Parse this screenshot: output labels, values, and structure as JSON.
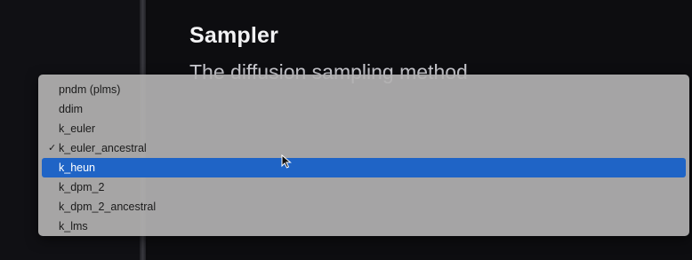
{
  "settings": {
    "title": "Sampler",
    "description": "The diffusion sampling method"
  },
  "dropdown": {
    "items": [
      {
        "label": "pndm (plms)"
      },
      {
        "label": "ddim"
      },
      {
        "label": "k_euler"
      },
      {
        "label": "k_euler_ancestral",
        "checked": true
      },
      {
        "label": "k_heun",
        "highlighted": true
      },
      {
        "label": "k_dpm_2"
      },
      {
        "label": "k_dpm_2_ancestral"
      },
      {
        "label": "k_lms"
      }
    ],
    "selected_value": "k_euler_ancestral",
    "hovered_value": "k_heun",
    "check_glyph": "✓"
  },
  "colors": {
    "highlight": "#1f64c6",
    "menu_background": "#b2b0b0",
    "app_background": "#0d0d10"
  },
  "icons": {
    "check": "checkmark-icon",
    "pointer": "mouse-pointer-icon"
  }
}
